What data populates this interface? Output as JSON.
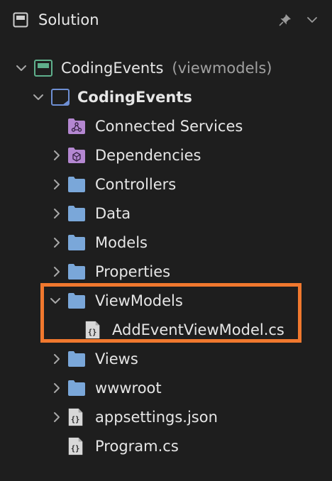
{
  "header": {
    "title": "Solution",
    "icons": [
      "solution-icon",
      "pin-icon",
      "chevron-down-icon"
    ]
  },
  "tree": {
    "solution": {
      "label": "CodingEvents",
      "suffix": "(viewmodels)",
      "expanded": true
    },
    "project": {
      "label": "CodingEvents",
      "expanded": true
    },
    "items": [
      {
        "label": "Connected Services",
        "icon": "connected-services-icon"
      },
      {
        "label": "Dependencies",
        "icon": "dependencies-icon"
      },
      {
        "label": "Controllers",
        "icon": "folder-icon"
      },
      {
        "label": "Data",
        "icon": "folder-icon"
      },
      {
        "label": "Models",
        "icon": "folder-icon"
      },
      {
        "label": "Properties",
        "icon": "folder-icon"
      },
      {
        "label": "ViewModels",
        "icon": "folder-icon",
        "expanded": true
      },
      {
        "label": "AddEventViewModel.cs",
        "icon": "csharp-file-icon"
      },
      {
        "label": "Views",
        "icon": "folder-icon"
      },
      {
        "label": "wwwroot",
        "icon": "folder-icon"
      },
      {
        "label": "appsettings.json",
        "icon": "json-file-icon"
      },
      {
        "label": "Program.cs",
        "icon": "csharp-file-icon"
      }
    ]
  },
  "colors": {
    "background": "#1e1e1e",
    "folder": "#7aa7d9",
    "highlight": "#f0782e",
    "solution_icon": "#5fb08c",
    "project_icon": "#6e8fd4",
    "package_icon": "#b487d1"
  }
}
